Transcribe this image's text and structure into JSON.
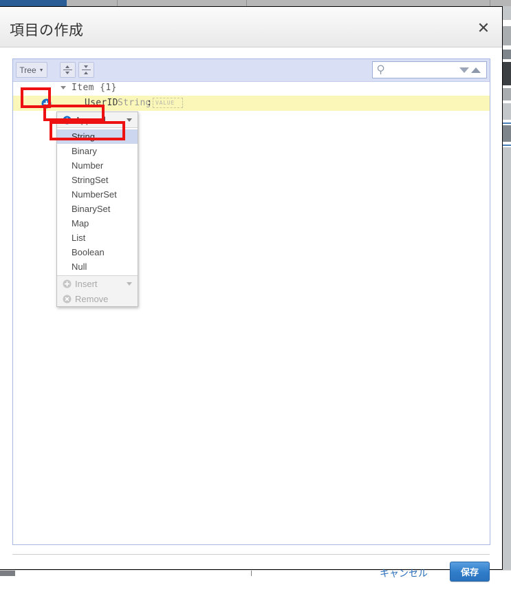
{
  "modal": {
    "title": "項目の作成",
    "close_label": "✕",
    "close_icon": "close-icon"
  },
  "toolbar": {
    "mode_label": "Tree",
    "mode_caret": "▼",
    "expand_all_icon": "expand-all-icon",
    "collapse_all_icon": "collapse-all-icon",
    "search_icon": "search-icon",
    "search_value": "",
    "search_placeholder": "",
    "search_next_icon": "chevron-down-icon",
    "search_prev_icon": "chevron-up-icon"
  },
  "tree": {
    "root": {
      "label": "Item {1}",
      "expander_icon": "triangle-down-icon"
    },
    "field": {
      "add_icon": "plus-circle-icon",
      "key": "UserID",
      "type": "String",
      "separator": ":",
      "value": "",
      "value_placeholder": "VALUE"
    }
  },
  "context_menu": {
    "append": {
      "label": "Append",
      "icon": "plus-circle-icon",
      "arrow_icon": "triangle-down-icon"
    },
    "types": [
      "String",
      "Binary",
      "Number",
      "StringSet",
      "NumberSet",
      "BinarySet",
      "Map",
      "List",
      "Boolean",
      "Null"
    ],
    "selected_type": "String",
    "insert": {
      "label": "Insert",
      "icon": "plus-circle-disabled-icon",
      "arrow_icon": "triangle-down-icon"
    },
    "remove": {
      "label": "Remove",
      "icon": "x-circle-disabled-icon"
    }
  },
  "footer": {
    "cancel_label": "キャンセル",
    "save_label": "保存"
  },
  "colors": {
    "accent_blue": "#2f7cc9",
    "link_blue": "#2a6fbb",
    "highlight_row": "#fbf7b8",
    "menu_selected": "#ccd6ee",
    "annotation_red": "#ee1111",
    "toolbar_bg": "#d9e0f5"
  }
}
